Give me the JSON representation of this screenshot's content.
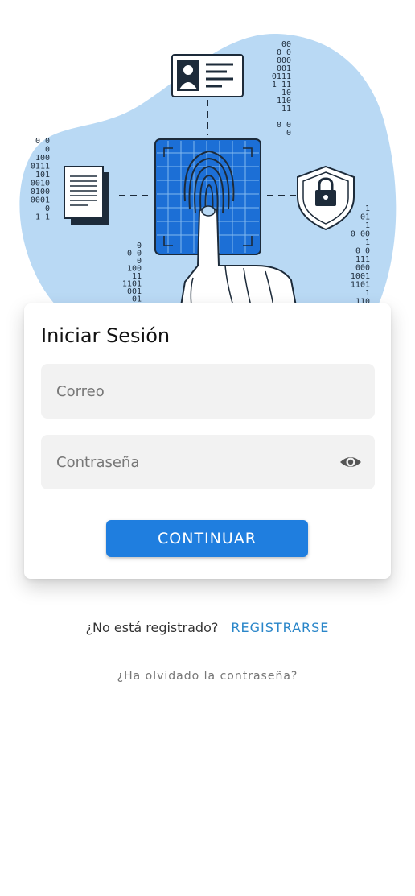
{
  "hero": {
    "binary_right_top": [
      "00",
      "0 0",
      "000",
      "001",
      "0111",
      "1 11",
      "10",
      "110",
      "11",
      "",
      "0 0",
      "0"
    ],
    "binary_left": [
      "0 0",
      "0",
      "100",
      "0111",
      "101",
      "0010",
      "0100",
      "0001",
      "0",
      "1 1"
    ],
    "binary_center": [
      "0",
      "0 0",
      "0",
      "100",
      "11",
      "1101",
      "001",
      "01"
    ],
    "binary_right_bottom": [
      "1",
      "01",
      "1",
      "0 00",
      "1",
      "0 0",
      "111",
      "000",
      "1001",
      "1101",
      "1",
      "110"
    ]
  },
  "login": {
    "title": "Iniciar Sesión",
    "email_placeholder": "Correo",
    "password_placeholder": "Contraseña",
    "continue_label": "CONTINUAR"
  },
  "register": {
    "question": "¿No está registrado?",
    "link": "REGISTRARSE"
  },
  "forgot_password": "¿Ha olvidado la contraseña?",
  "colors": {
    "accent": "#1f7edf",
    "link": "#2a86c9",
    "blob": "#b9d9f4",
    "illustration_blue": "#1c6fd6"
  }
}
